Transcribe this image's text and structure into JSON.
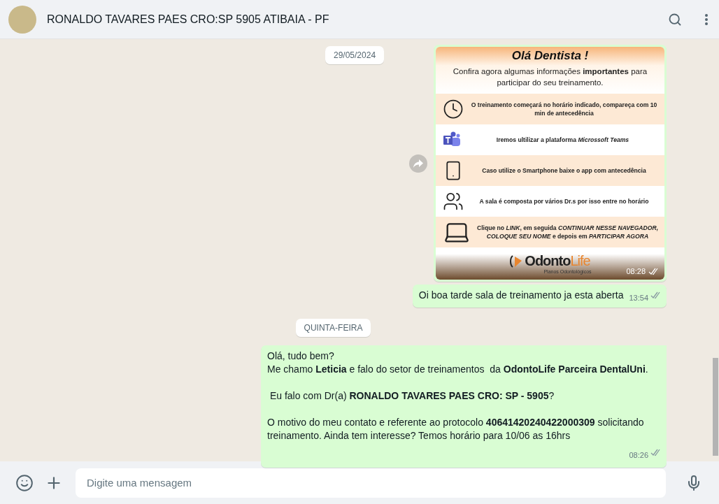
{
  "header": {
    "title": "RONALDO TAVARES PAES CRO:SP 5905 ATIBAIA - PF"
  },
  "sticky_date": "29/05/2024",
  "messages": [
    {
      "kind": "image",
      "time": "08:28",
      "read": false,
      "forward": true,
      "flyer": {
        "title": "Olá Dentista !",
        "subtitle": "Confira agora algumas informações **importantes** para participar do seu treinamento.",
        "rows": [
          {
            "kind": "clock",
            "text": "O treinamento começará no horário indicado, compareça com 10 min de antecedência",
            "shaded": true
          },
          {
            "kind": "teams",
            "text": "Iremos ultilizar a plataforma *Microssoft Teams*",
            "shaded": false
          },
          {
            "kind": "phone",
            "text": "Caso utilize o Smartphone baixe o app com antecedência",
            "shaded": true
          },
          {
            "kind": "people",
            "text": "A sala é composta por vários Dr.s por isso entre no horário",
            "shaded": false
          },
          {
            "kind": "laptop",
            "text": "Clique no *LINK*, em seguida *CONTINUAR NESSE NAVEGADOR, COLOQUE SEU NOME* e depois em *PARTICIPAR AGORA*",
            "shaded": true
          }
        ],
        "logo": [
          "Odonto",
          "Life"
        ],
        "tagline": "Planos Odontológicos"
      }
    },
    {
      "kind": "text",
      "time": "13:54",
      "read": false,
      "paragraphs": [
        [
          "Oi boa tarde sala de treinamento ja esta aberta"
        ]
      ]
    },
    {
      "kind": "date",
      "label": "QUINTA-FEIRA"
    },
    {
      "kind": "text",
      "time": "08:26",
      "read": false,
      "tail": true,
      "paragraphs": [
        [
          "Olá, tudo bem?",
          "Me chamo **Leticia** e falo do setor de treinamentos  da **OdontoLife Parceira DentalUni**."
        ],
        [
          " Eu falo com Dr(a) **RONALDO TAVARES PAES CRO: SP - 5905**?"
        ],
        [
          "O motivo do meu contato e referente ao protocolo **40641420240422000309** solicitando treinamento. Ainda tem interesse? Temos horário para 10/06 as 16hrs"
        ]
      ]
    }
  ],
  "composer": {
    "placeholder": "Digite uma mensagem"
  }
}
